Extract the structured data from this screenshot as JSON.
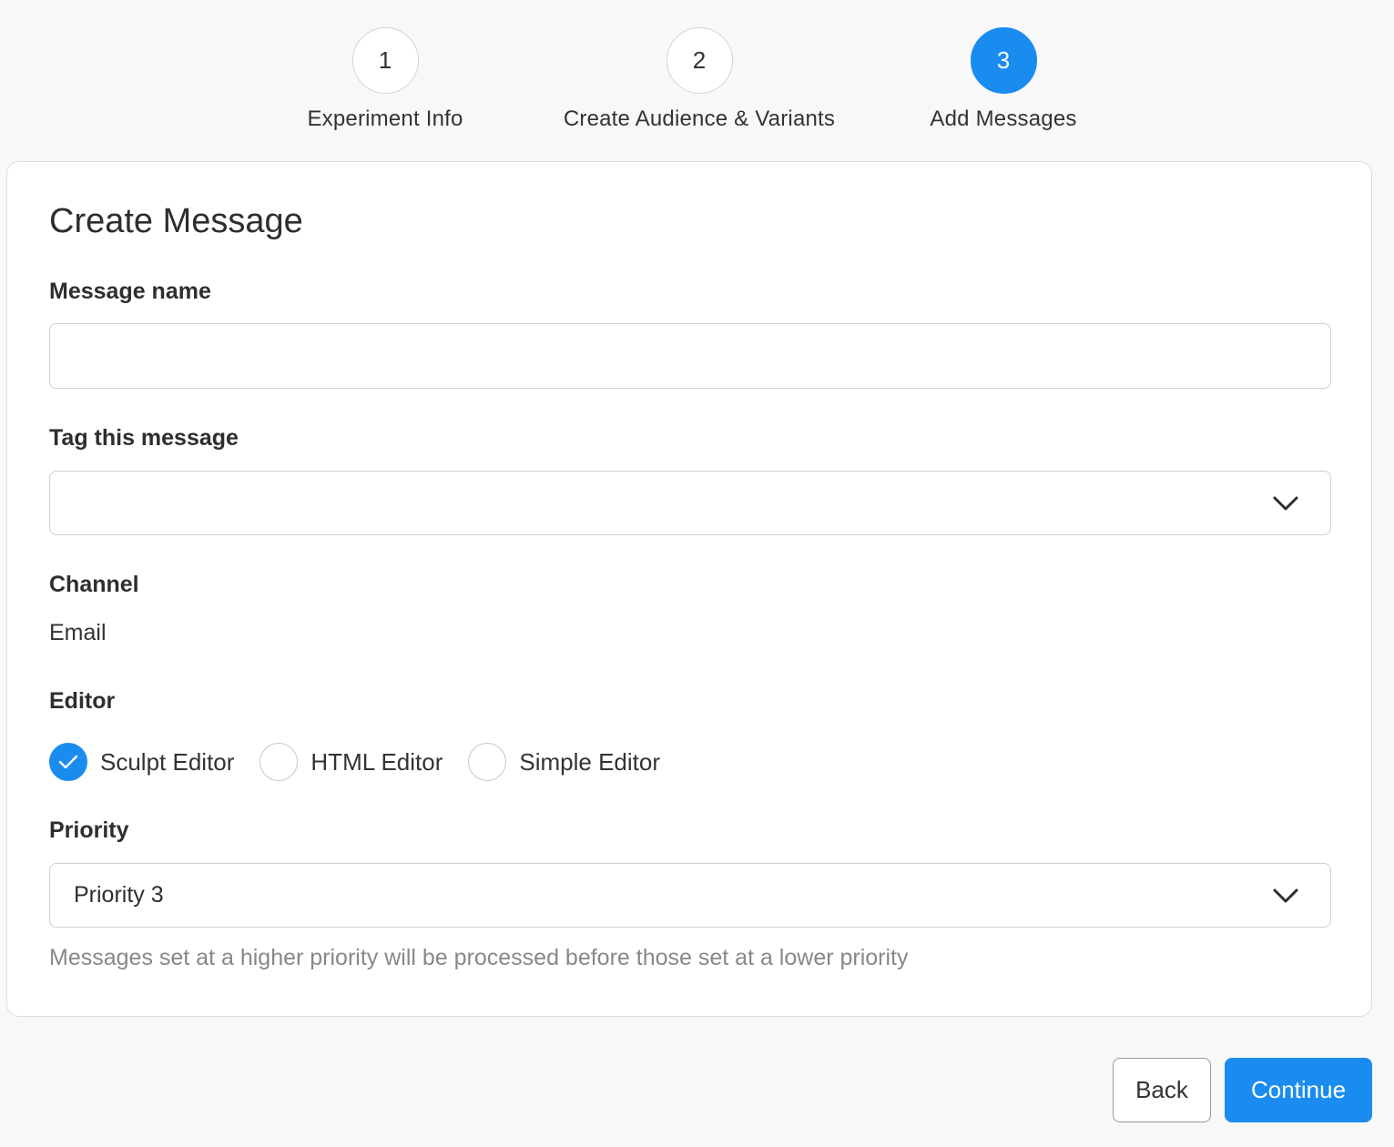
{
  "stepper": {
    "steps": [
      {
        "number": "1",
        "label": "Experiment Info",
        "active": false
      },
      {
        "number": "2",
        "label": "Create Audience & Variants",
        "active": false
      },
      {
        "number": "3",
        "label": "Add Messages",
        "active": true
      }
    ]
  },
  "form": {
    "title": "Create Message",
    "message_name": {
      "label": "Message name",
      "value": ""
    },
    "tag": {
      "label": "Tag this message",
      "value": ""
    },
    "channel": {
      "label": "Channel",
      "value": "Email"
    },
    "editor": {
      "label": "Editor",
      "options": [
        {
          "label": "Sculpt Editor",
          "checked": true
        },
        {
          "label": "HTML Editor",
          "checked": false
        },
        {
          "label": "Simple Editor",
          "checked": false
        }
      ]
    },
    "priority": {
      "label": "Priority",
      "value": "Priority 3",
      "helper": "Messages set at a higher priority will be processed before those set at a lower priority"
    }
  },
  "actions": {
    "back_label": "Back",
    "continue_label": "Continue"
  },
  "colors": {
    "accent": "#1a8cf0",
    "background": "#f8f8f8",
    "card": "#ffffff",
    "helper_text": "#888888"
  },
  "icons": {
    "dropdown": "chevron-down-icon",
    "radio_checked": "checkmark-icon"
  }
}
